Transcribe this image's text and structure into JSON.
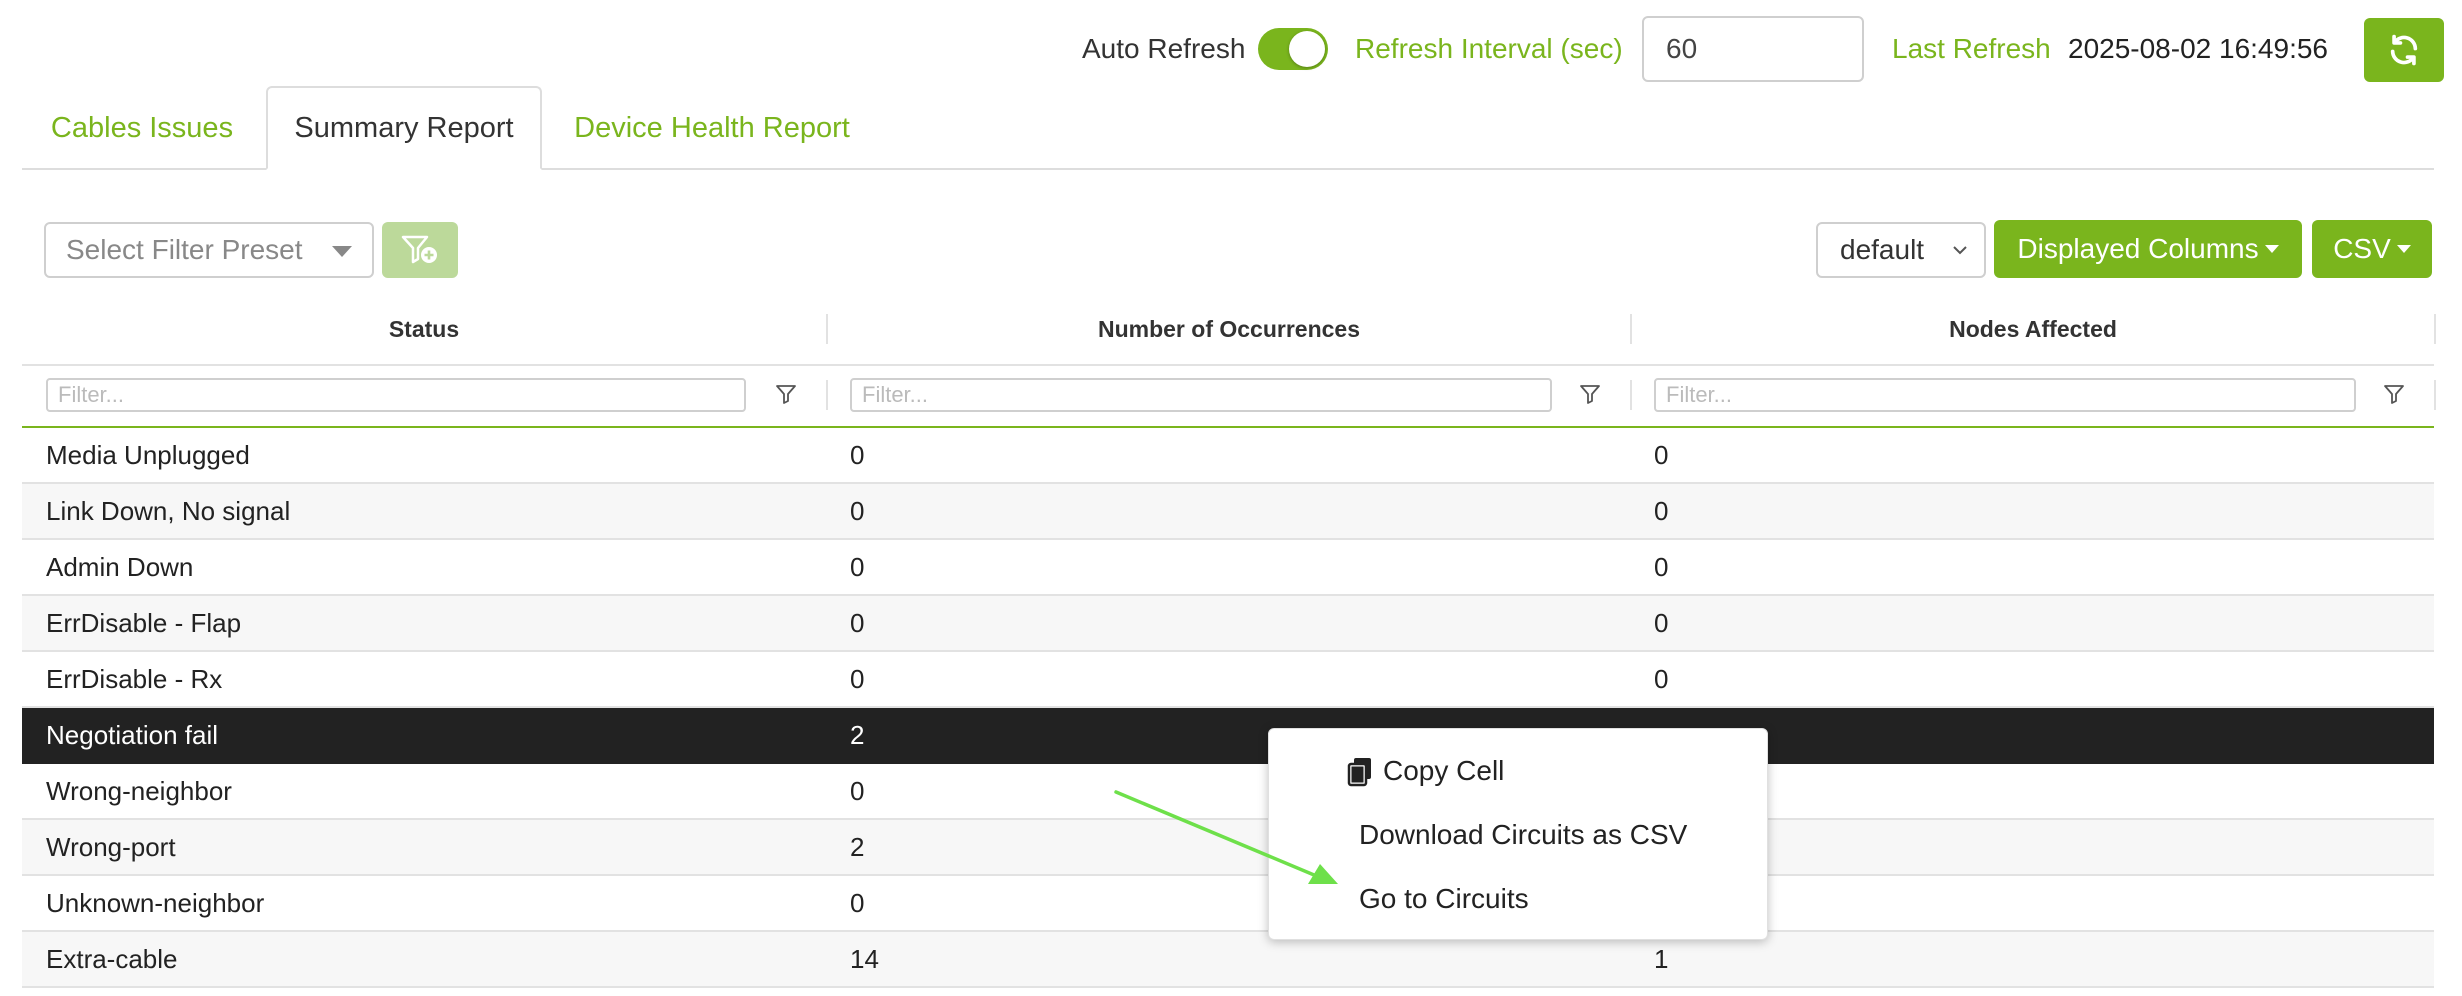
{
  "header": {
    "auto_refresh_label": "Auto Refresh",
    "auto_refresh_on": true,
    "refresh_interval_label": "Refresh Interval (sec)",
    "refresh_interval_value": "60",
    "last_refresh_label": "Last Refresh",
    "last_refresh_value": "2025-08-02 16:49:56",
    "refresh_icon": "refresh-icon"
  },
  "tabs": [
    {
      "label": "Cables Issues",
      "active": false
    },
    {
      "label": "Summary Report",
      "active": true
    },
    {
      "label": "Device Health Report",
      "active": false
    }
  ],
  "toolbar": {
    "filter_preset_placeholder": "Select Filter Preset",
    "add_filter_icon": "filter-add-icon",
    "view_select_value": "default",
    "displayed_columns_label": "Displayed Columns",
    "csv_label": "CSV"
  },
  "table": {
    "columns": [
      "Status",
      "Number of Occurrences",
      "Nodes Affected"
    ],
    "filter_placeholder": "Filter...",
    "rows": [
      {
        "status": "Media Unplugged",
        "occurrences": "0",
        "nodes": "0"
      },
      {
        "status": "Link Down, No signal",
        "occurrences": "0",
        "nodes": "0"
      },
      {
        "status": "Admin Down",
        "occurrences": "0",
        "nodes": "0"
      },
      {
        "status": "ErrDisable - Flap",
        "occurrences": "0",
        "nodes": "0"
      },
      {
        "status": "ErrDisable - Rx",
        "occurrences": "0",
        "nodes": "0"
      },
      {
        "status": "Negotiation fail",
        "occurrences": "2",
        "nodes": "",
        "selected": true
      },
      {
        "status": "Wrong-neighbor",
        "occurrences": "0",
        "nodes": ""
      },
      {
        "status": "Wrong-port",
        "occurrences": "2",
        "nodes": ""
      },
      {
        "status": "Unknown-neighbor",
        "occurrences": "0",
        "nodes": ""
      },
      {
        "status": "Extra-cable",
        "occurrences": "14",
        "nodes": "1"
      }
    ]
  },
  "context_menu": {
    "items": [
      {
        "label": "Copy Cell",
        "icon": "copy-icon"
      },
      {
        "label": "Download Circuits as CSV"
      },
      {
        "label": "Go to Circuits"
      }
    ]
  },
  "colors": {
    "accent": "#7ab51d",
    "selected_row": "#222222",
    "annotation_arrow": "#6ee04a"
  }
}
